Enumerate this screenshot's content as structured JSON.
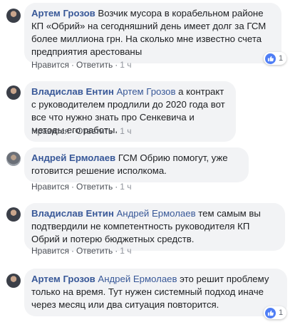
{
  "comments": [
    {
      "author": "Артем Грозов",
      "mention": "",
      "text": " Возчик мусора в корабельном районе КП «Обрий» на сегодняшний день имеет долг за ГСМ более миллиона грн. На сколько мне известно счета предприятия арестованы",
      "reactions": "1",
      "like_label": "Нравится",
      "reply_label": "Ответить",
      "sep": "·",
      "time": "1 ч"
    },
    {
      "author": "Владислав Ентин",
      "mention": " Артем Грозов",
      "text": " а контракт с руководителем продлили до 2020 года вот все что нужно знать про Сенкевича и методы его работы.",
      "like_label": "Нравится",
      "reply_label": "Ответить",
      "sep": "·",
      "time": "1 ч"
    },
    {
      "author": "Андрей Ермолаев",
      "mention": "",
      "text": " ГСМ Обрию помогут, уже готовится решение исполкома.",
      "like_label": "Нравится",
      "reply_label": "Ответить",
      "sep": "·",
      "time": "1 ч"
    },
    {
      "author": "Владислав Ентин",
      "mention": " Андрей Ермолаев",
      "text": " тем самым вы подтвердили не компетентность руководителя КП Обрий и потерю бюджетных средств.",
      "like_label": "Нравится",
      "reply_label": "Ответить",
      "sep": "·",
      "time": "1 ч"
    },
    {
      "author": "Артем Грозов",
      "mention": " Андрей Ермолаев",
      "text": " это решит проблему только на время. Тут нужен системный подход иначе через месяц или два ситуация повторится.",
      "reactions": "1",
      "like_label": "Нравится",
      "reply_label": "Ответить",
      "sep": "·",
      "time": "1 ч"
    }
  ],
  "colors": {
    "name": "#385898",
    "bubble": "#f2f3f5",
    "like": "#4f7ef5"
  }
}
